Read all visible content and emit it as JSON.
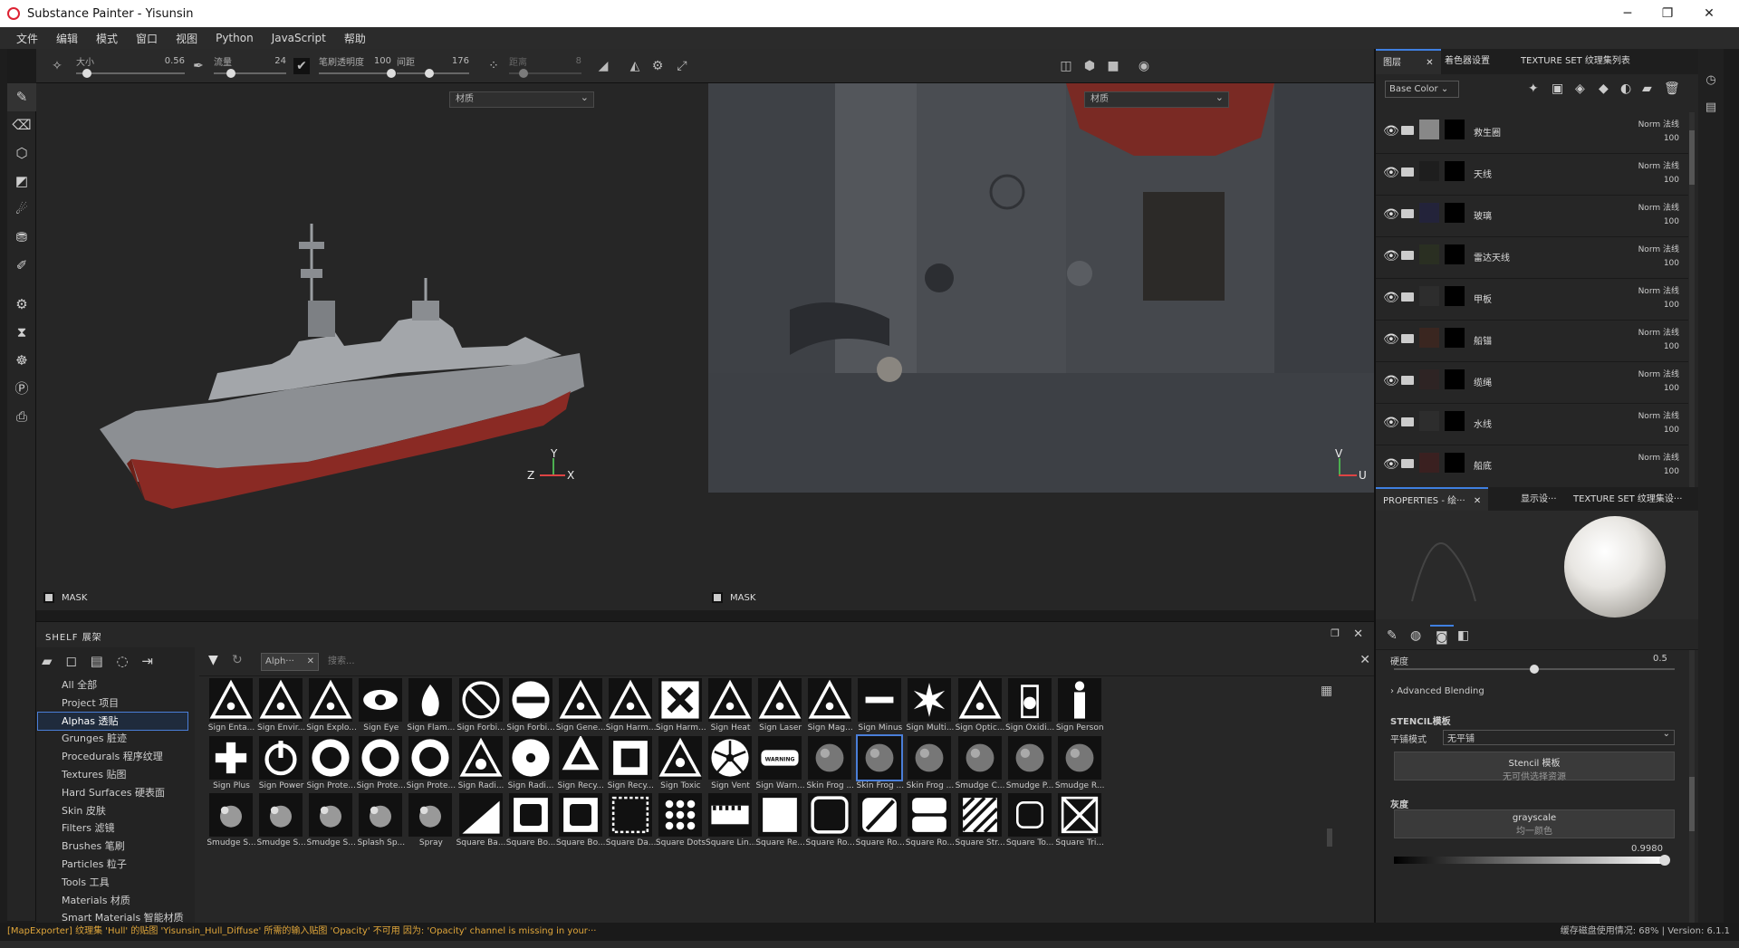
{
  "window": {
    "title": "Substance Painter - Yisunsin"
  },
  "menu": [
    "文件",
    "编辑",
    "模式",
    "窗口",
    "视图",
    "Python",
    "JavaScript",
    "帮助"
  ],
  "toolbar": {
    "size_label": "大小",
    "size_value": "0.56",
    "size_level": 0.1,
    "flow_label": "流量",
    "flow_value": "24",
    "flow_level": 0.24,
    "opacity_label": "笔刷透明度",
    "opacity_value": "100",
    "opacity_level": 1.0,
    "spacing_label": "间距",
    "spacing_value": "176",
    "spacing_level": 0.45,
    "distance_label": "距离",
    "distance_value": "8",
    "distance_level": 0.2
  },
  "viewport3d": {
    "material_label": "材质",
    "mask_label": "MASK",
    "axis_y": "Y",
    "axis_z": "Z",
    "axis_x": "X"
  },
  "viewport2d": {
    "material_label": "材质",
    "mask_label": "MASK",
    "axis_v": "V",
    "axis_u": "U"
  },
  "shelf": {
    "title": "SHELF 展架",
    "filter_chip": "Alph···",
    "search_placeholder": "搜索...",
    "categories": [
      "All 全部",
      "Project 项目",
      "Alphas 透贴",
      "Grunges 脏迹",
      "Procedurals 程序纹理",
      "Textures 贴图",
      "Hard Surfaces 硬表面",
      "Skin 皮肤",
      "Filters 滤镜",
      "Brushes 笔刷",
      "Particles 粒子",
      "Tools 工具",
      "Materials 材质",
      "Smart Materials 智能材质"
    ],
    "selected_category": 2,
    "row1": [
      "Sign Enta...",
      "Sign Envir...",
      "Sign Explo...",
      "Sign Eye",
      "Sign Flam...",
      "Sign Forbi...",
      "Sign Forbi...",
      "Sign Gene...",
      "Sign Harm...",
      "Sign Harm...",
      "Sign Heat",
      "Sign Laser",
      "Sign Mag...",
      "Sign Minus",
      "Sign Multi...",
      "Sign Optic...",
      "Sign Oxidi...",
      "Sign Person"
    ],
    "row2": [
      "Sign Plus",
      "Sign Power",
      "Sign Prote...",
      "Sign Prote...",
      "Sign Prote...",
      "Sign Radi...",
      "Sign Radi...",
      "Sign Recy...",
      "Sign Recy...",
      "Sign Toxic",
      "Sign Vent",
      "Sign Warn...",
      "Skin Frog ...",
      "Skin Frog ...",
      "Skin Frog ...",
      "Smudge C...",
      "Smudge P...",
      "Smudge R..."
    ],
    "row3": [
      "Smudge S...",
      "Smudge S...",
      "Smudge S...",
      "Splash Sp...",
      "Spray",
      "Square Ba...",
      "Square Bo...",
      "Square Bo...",
      "Square Da...",
      "Square Dots",
      "Square Lin...",
      "Square Re...",
      "Square Ro...",
      "Square Ro...",
      "Square Ro...",
      "Square Str...",
      "Square To...",
      "Square Tri..."
    ],
    "warning_text": "WARNING"
  },
  "layers_panel": {
    "tabs": [
      "图层",
      "着色器设置",
      "TEXTURE SET 纹理集列表"
    ],
    "channel": "Base Color",
    "layers": [
      {
        "name": "救生圈",
        "blend": "Norm 法线",
        "opacity": "100"
      },
      {
        "name": "天线",
        "blend": "Norm 法线",
        "opacity": "100"
      },
      {
        "name": "玻璃",
        "blend": "Norm 法线",
        "opacity": "100"
      },
      {
        "name": "雷达天线",
        "blend": "Norm 法线",
        "opacity": "100"
      },
      {
        "name": "甲板",
        "blend": "Norm 法线",
        "opacity": "100"
      },
      {
        "name": "船锚",
        "blend": "Norm 法线",
        "opacity": "100"
      },
      {
        "name": "缆绳",
        "blend": "Norm 法线",
        "opacity": "100"
      },
      {
        "name": "水线",
        "blend": "Norm 法线",
        "opacity": "100"
      },
      {
        "name": "船底",
        "blend": "Norm 法线",
        "opacity": "100"
      }
    ]
  },
  "properties": {
    "tabs": [
      "PROPERTIES - 绘···",
      "显示设···",
      "TEXTURE SET 纹理集设···"
    ],
    "hardness_label": "硬度",
    "hardness_value": "0.5",
    "hardness_level": 0.5,
    "advanced_blending": "Advanced Blending",
    "stencil_header": "STENCIL模板",
    "tiling_label": "平铺模式",
    "tiling_value": "无平铺",
    "stencil_btn": "Stencil 模板",
    "stencil_btn_sub": "无可供选择资源",
    "gray_header": "灰度",
    "gray_btn": "grayscale",
    "gray_btn_sub": "均一颜色",
    "gray_value": "0.9980",
    "gray_level": 0.998
  },
  "status": {
    "message": "[MapExporter] 纹理集 'Hull' 的贴图 'Yisunsin_Hull_Diffuse' 所需的输入贴图 'Opacity' 不可用 因为: 'Opacity' channel is missing in your···",
    "cache": "缓存磁盘使用情况:",
    "cache_value": "68%",
    "version": "Version: 6.1.1"
  },
  "colors": {
    "accent": "#3f7fe0",
    "warning": "#e0a63a",
    "hull_red": "#8a2a24"
  }
}
